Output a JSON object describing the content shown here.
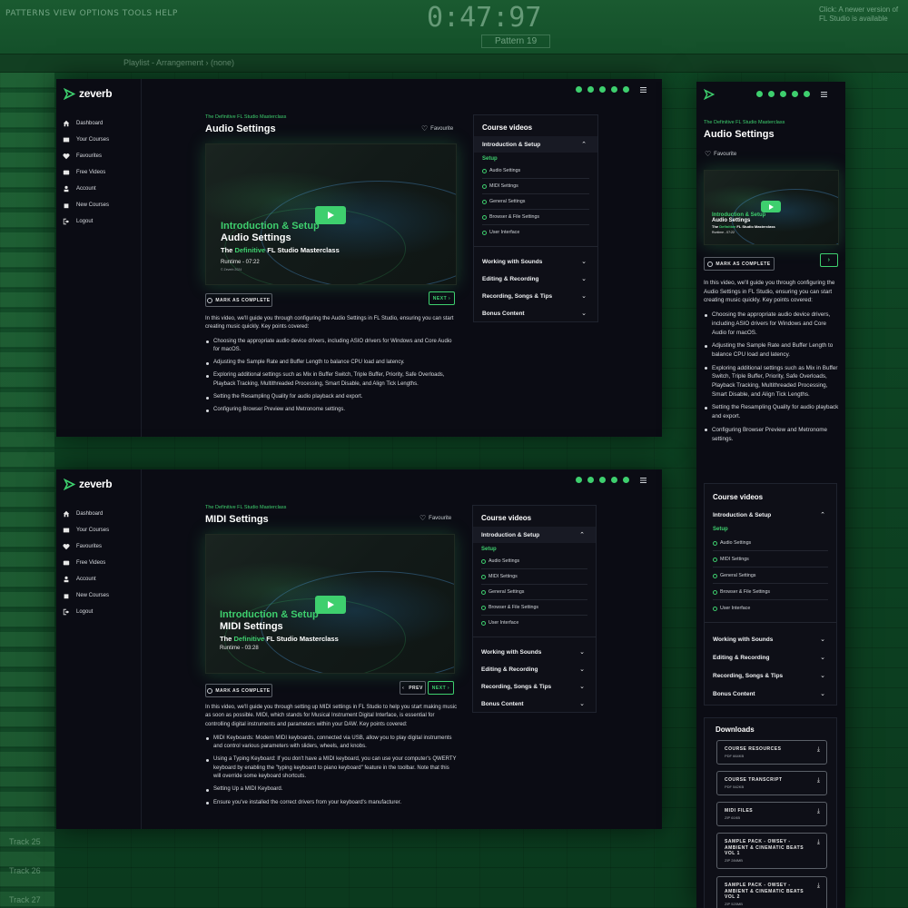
{
  "daw": {
    "menu": "PATTERNS VIEW OPTIONS TOOLS HELP",
    "time": "0:47:97",
    "tip": "Click: A newer version of FL Studio is available",
    "pattern": "Pattern 19",
    "playlist": "Playlist - Arrangement › (none)",
    "track_labels": [
      "Track 25",
      "Track 26",
      "Track 27"
    ]
  },
  "brand": {
    "name": "zeverb",
    "accent": "#3ecf6e"
  },
  "nav_items": [
    {
      "label": "Dashboard",
      "icon": "home-icon"
    },
    {
      "label": "Your Courses",
      "icon": "courses-icon"
    },
    {
      "label": "Favourites",
      "icon": "heart-icon"
    },
    {
      "label": "Free Videos",
      "icon": "video-icon"
    },
    {
      "label": "Account",
      "icon": "user-icon"
    },
    {
      "label": "New Courses",
      "icon": "bag-icon"
    },
    {
      "label": "Logout",
      "icon": "logout-icon"
    }
  ],
  "social_icons": [
    "facebook-icon",
    "instagram-icon",
    "youtube-icon",
    "tiktok-icon",
    "discord-icon"
  ],
  "course_name": "The Definitive FL Studio Masterclass",
  "favourite_label": "Favourite",
  "mark_complete_label": "MARK AS COMPLETE",
  "next_label": "NEXT",
  "prev_label": "PREV",
  "video_overlay": {
    "course_prefix": "The",
    "course_highlight": "Definitive",
    "course_suffix": "FL Studio Masterclass",
    "copyright": "© Zeverb 2024"
  },
  "audio_page": {
    "title": "Audio Settings",
    "section": "Introduction & Setup",
    "runtime": "Runtime - 07:22",
    "intro": "In this video, we'll guide you through configuring the Audio Settings in FL Studio, ensuring you can start creating music quickly. Key points covered:",
    "bullets": [
      "Choosing the appropriate audio device drivers, including ASIO drivers for Windows and Core Audio for macOS.",
      "Adjusting the Sample Rate and Buffer Length to balance CPU load and latency.",
      "Exploring additional settings such as Mix in Buffer Switch, Triple Buffer, Priority, Safe Overloads, Playback Tracking, Multithreaded Processing, Smart Disable, and Align Tick Lengths.",
      "Setting the Resampling Quality for audio playback and export.",
      "Configuring Browser Preview and Metronome settings."
    ]
  },
  "midi_page": {
    "title": "MIDI Settings",
    "section": "Introduction & Setup",
    "runtime": "Runtime - 03:28",
    "intro": "In this video, we'll guide you through setting up MIDI settings in FL Studio to help you start making music as soon as possible. MIDI, which stands for Musical Instrument Digital Interface, is essential for controlling digital instruments and parameters within your DAW. Key points covered:",
    "bullets": [
      "MIDI Keyboards: Modern MIDI keyboards, connected via USB, allow you to play digital instruments and control various parameters with sliders, wheels, and knobs.",
      "Using a Typing Keyboard: If you don't have a MIDI keyboard, you can use your computer's QWERTY keyboard by enabling the \"typing keyboard to piano keyboard\" feature in the toolbar. Note that this will override some keyboard shortcuts.",
      "Setting Up a MIDI Keyboard.",
      "Ensure you've installed the correct drivers from your keyboard's manufacturer."
    ]
  },
  "course_videos": {
    "heading": "Course videos",
    "open_section": "Introduction & Setup",
    "subheading": "Setup",
    "lessons": [
      "Audio Settings",
      "MIDI Settings",
      "General Settings",
      "Browser & File Settings",
      "User Interface"
    ],
    "sections": [
      "Working with Sounds",
      "Editing & Recording",
      "Recording, Songs & Tips",
      "Bonus Content"
    ]
  },
  "downloads": {
    "heading": "Downloads",
    "items": [
      {
        "name": "COURSE RESOURCES",
        "meta": "PDF 664KB"
      },
      {
        "name": "COURSE TRANSCRIPT",
        "meta": "PDF 542KB"
      },
      {
        "name": "MIDI FILES",
        "meta": "ZIP 61KB"
      },
      {
        "name": "SAMPLE PACK - OWSEY - AMBIENT & CINEMATIC BEATS VOL 1",
        "meta": "ZIP 284MB"
      },
      {
        "name": "SAMPLE PACK - OWSEY - AMBIENT & CINEMATIC BEATS VOL 2",
        "meta": "ZIP 520MB"
      }
    ]
  }
}
